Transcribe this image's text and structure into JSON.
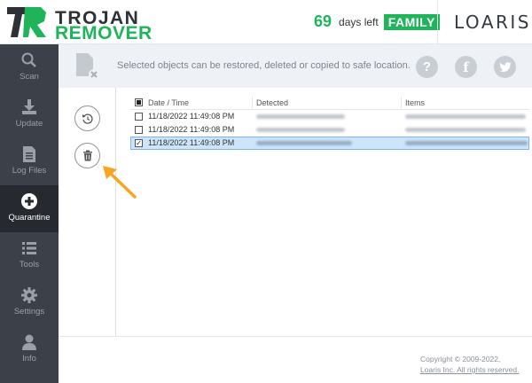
{
  "app": {
    "logo_top": "TROJAN",
    "logo_bottom": "REMOVER",
    "days_count": "69",
    "days_text": "days left",
    "plan_badge": "FAMILY",
    "brand": "LOARIS"
  },
  "sidebar": {
    "items": [
      {
        "label": "Scan",
        "icon": "search-icon"
      },
      {
        "label": "Update",
        "icon": "download-icon"
      },
      {
        "label": "Log Files",
        "icon": "document-icon"
      },
      {
        "label": "Quarantine",
        "icon": "plus-circle-icon",
        "active": true
      },
      {
        "label": "Tools",
        "icon": "list-icon"
      },
      {
        "label": "Settings",
        "icon": "gear-icon"
      },
      {
        "label": "Info",
        "icon": "user-icon"
      }
    ]
  },
  "infobar": {
    "message": "Selected objects can be restored, deleted or copied to safe location.",
    "help_glyph": "?",
    "facebook_glyph": "f"
  },
  "table": {
    "headers": {
      "date": "Date / Time",
      "detected": "Detected",
      "items": "Items"
    },
    "rows": [
      {
        "date": "11/18/2022 11:49:08 PM",
        "checked": false,
        "selected": false
      },
      {
        "date": "11/18/2022 11:49:08 PM",
        "checked": false,
        "selected": false
      },
      {
        "date": "11/18/2022 11:49:08 PM",
        "checked": true,
        "selected": true
      }
    ]
  },
  "footer": {
    "copyright": "Copyright © 2009-2022,",
    "rights": "Loaris Inc. All rights reserved."
  },
  "colors": {
    "accent_green": "#1fb45a",
    "sidebar_bg": "#3c4048",
    "sidebar_active": "#262a30",
    "selection": "#cde5fb",
    "arrow": "#f5a623"
  }
}
